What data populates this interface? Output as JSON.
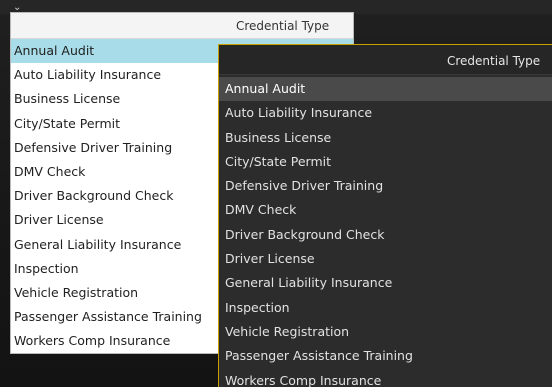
{
  "back_dropdown": {
    "header": "Credential Type",
    "caret_icon": "chevron-down-icon",
    "selected_index": 0,
    "accent": "#a8dce9",
    "items": [
      "Annual Audit",
      "Auto Liability Insurance",
      "Business License",
      "City/State Permit",
      "Defensive Driver Training",
      "DMV Check",
      "Driver Background Check",
      "Driver License",
      "General Liability Insurance",
      "Inspection",
      "Vehicle Registration",
      "Passenger Assistance Training",
      "Workers Comp Insurance"
    ]
  },
  "front_dropdown": {
    "header": "Credential Type",
    "selected_index": 0,
    "border_color": "#c8a000",
    "items": [
      "Annual Audit",
      "Auto Liability Insurance",
      "Business License",
      "City/State Permit",
      "Defensive Driver Training",
      "DMV Check",
      "Driver Background Check",
      "Driver License",
      "General Liability Insurance",
      "Inspection",
      "Vehicle Registration",
      "Passenger Assistance Training",
      "Workers Comp Insurance"
    ]
  }
}
